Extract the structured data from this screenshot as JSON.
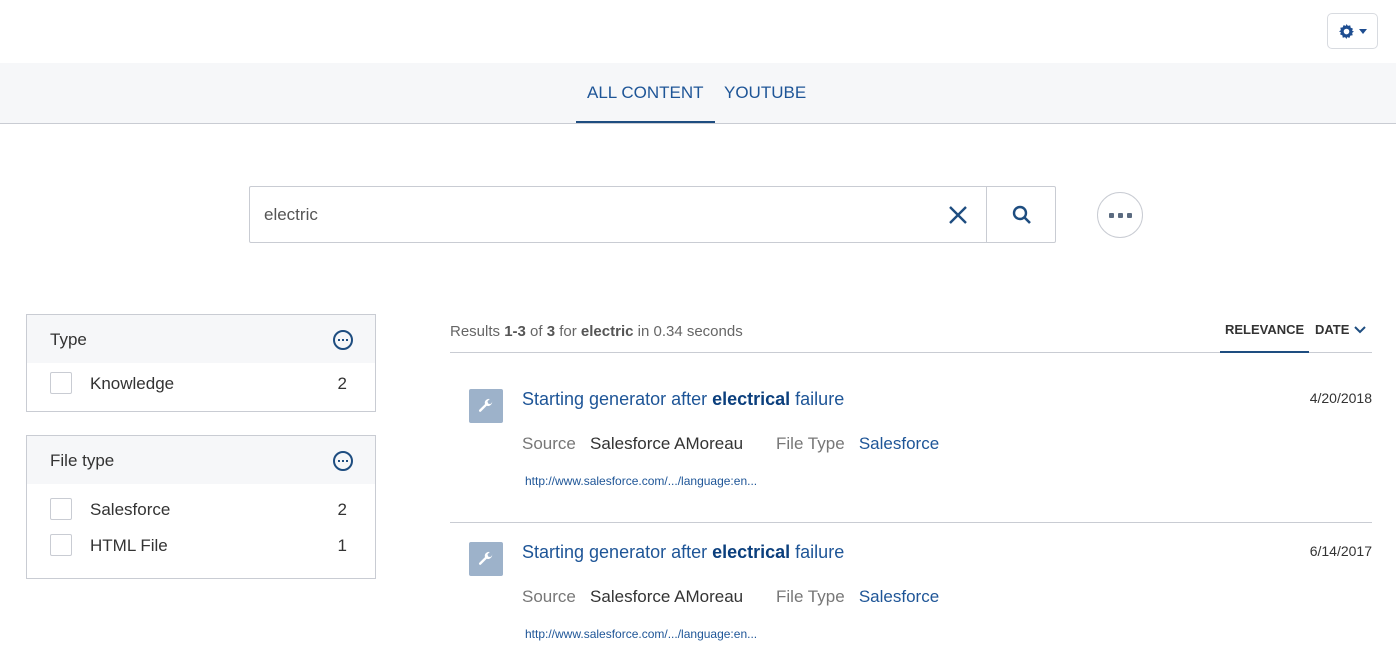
{
  "header": {
    "settings_icon": "gear-icon",
    "dropdown_icon": "caret-down-icon"
  },
  "tabs": [
    {
      "label": "ALL CONTENT",
      "active": true
    },
    {
      "label": "YOUTUBE",
      "active": false
    }
  ],
  "search": {
    "value": "electric",
    "placeholder": "",
    "clear_icon": "close-icon",
    "search_icon": "search-icon",
    "more_icon": "ellipsis-icon"
  },
  "facets": [
    {
      "title": "Type",
      "values": [
        {
          "label": "Knowledge",
          "count": "2",
          "checked": false
        }
      ]
    },
    {
      "title": "File type",
      "values": [
        {
          "label": "Salesforce",
          "count": "2",
          "checked": false
        },
        {
          "label": "HTML File",
          "count": "1",
          "checked": false
        }
      ]
    }
  ],
  "summary": {
    "prefix": "Results ",
    "range": "1-3",
    "of": " of ",
    "total": "3",
    "for": " for ",
    "query": "electric",
    "suffix": " in 0.34 seconds"
  },
  "sort": [
    {
      "label": "RELEVANCE",
      "active": true
    },
    {
      "label": "DATE",
      "active": false
    }
  ],
  "results": [
    {
      "title_pre": "Starting generator after ",
      "title_hl": "electrical",
      "title_post": " failure",
      "date": "4/20/2018",
      "source_label": "Source",
      "source": "Salesforce AMoreau",
      "filetype_label": "File Type",
      "filetype": "Salesforce",
      "url": "http://www.salesforce.com/.../language:en...",
      "icon": "wrench-icon"
    },
    {
      "title_pre": "Starting generator after ",
      "title_hl": "electrical",
      "title_post": " failure",
      "date": "6/14/2017",
      "source_label": "Source",
      "source": "Salesforce AMoreau",
      "filetype_label": "File Type",
      "filetype": "Salesforce",
      "url": "http://www.salesforce.com/.../language:en...",
      "icon": "wrench-icon"
    }
  ],
  "colors": {
    "accent": "#1e5597",
    "icon_bg": "#9db2ca",
    "tab_bar": "#f6f7f9"
  }
}
